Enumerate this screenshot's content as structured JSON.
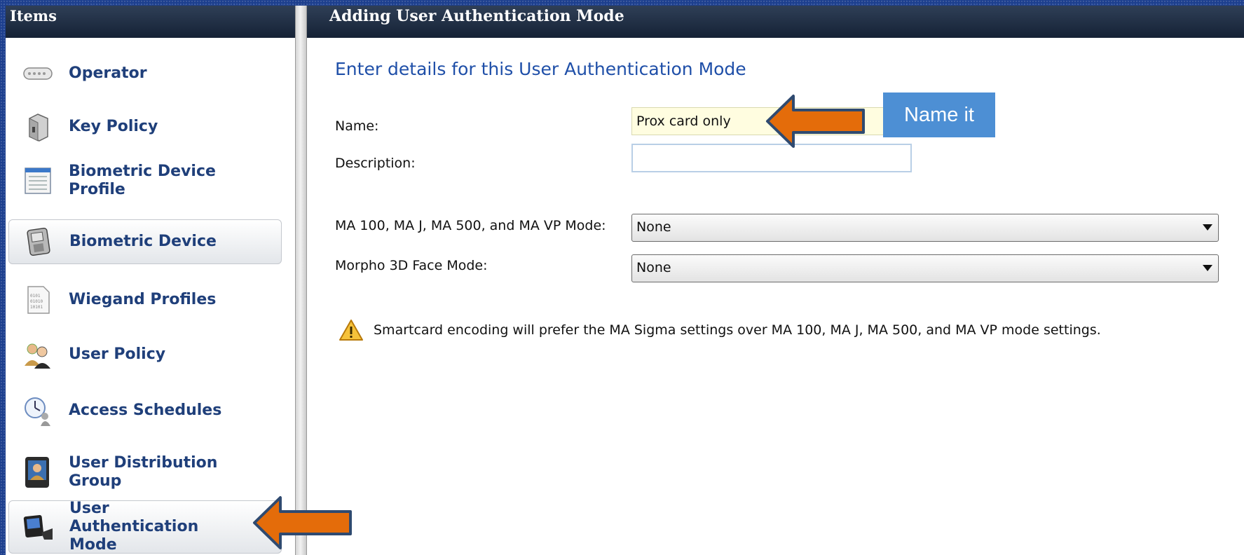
{
  "left_panel": {
    "header": "Items",
    "items": [
      {
        "label": "Operator",
        "icon": "operator-icon"
      },
      {
        "label": "Key Policy",
        "icon": "key-policy-icon"
      },
      {
        "label": "Biometric Device Profile",
        "icon": "device-profile-icon"
      },
      {
        "label": "Biometric Device",
        "icon": "biometric-device-icon",
        "selected": true
      },
      {
        "label": "Wiegand Profiles",
        "icon": "wiegand-icon"
      },
      {
        "label": "User Policy",
        "icon": "user-policy-icon"
      },
      {
        "label": "Access Schedules",
        "icon": "access-schedule-icon"
      },
      {
        "label": "User Distribution Group",
        "icon": "distribution-group-icon"
      },
      {
        "label": "User Authentication Mode",
        "icon": "auth-mode-icon",
        "selected": true
      }
    ]
  },
  "main": {
    "header": "Adding User Authentication Mode",
    "section_title": "Enter details for this User Authentication Mode",
    "fields": {
      "name": {
        "label": "Name:",
        "value": "Prox card only"
      },
      "description": {
        "label": "Description:",
        "value": ""
      },
      "ma_mode": {
        "label": "MA 100, MA J, MA 500, and MA VP Mode:",
        "value": "None"
      },
      "morpho_mode": {
        "label": "Morpho 3D Face Mode:",
        "value": "None"
      }
    },
    "warning": "Smartcard encoding will prefer the MA Sigma settings over MA 100, MA J, MA 500, and MA VP mode settings."
  },
  "annotations": {
    "callout": "Name it",
    "arrow_color": "#e46c0a",
    "arrow_border": "#2f4a70"
  }
}
